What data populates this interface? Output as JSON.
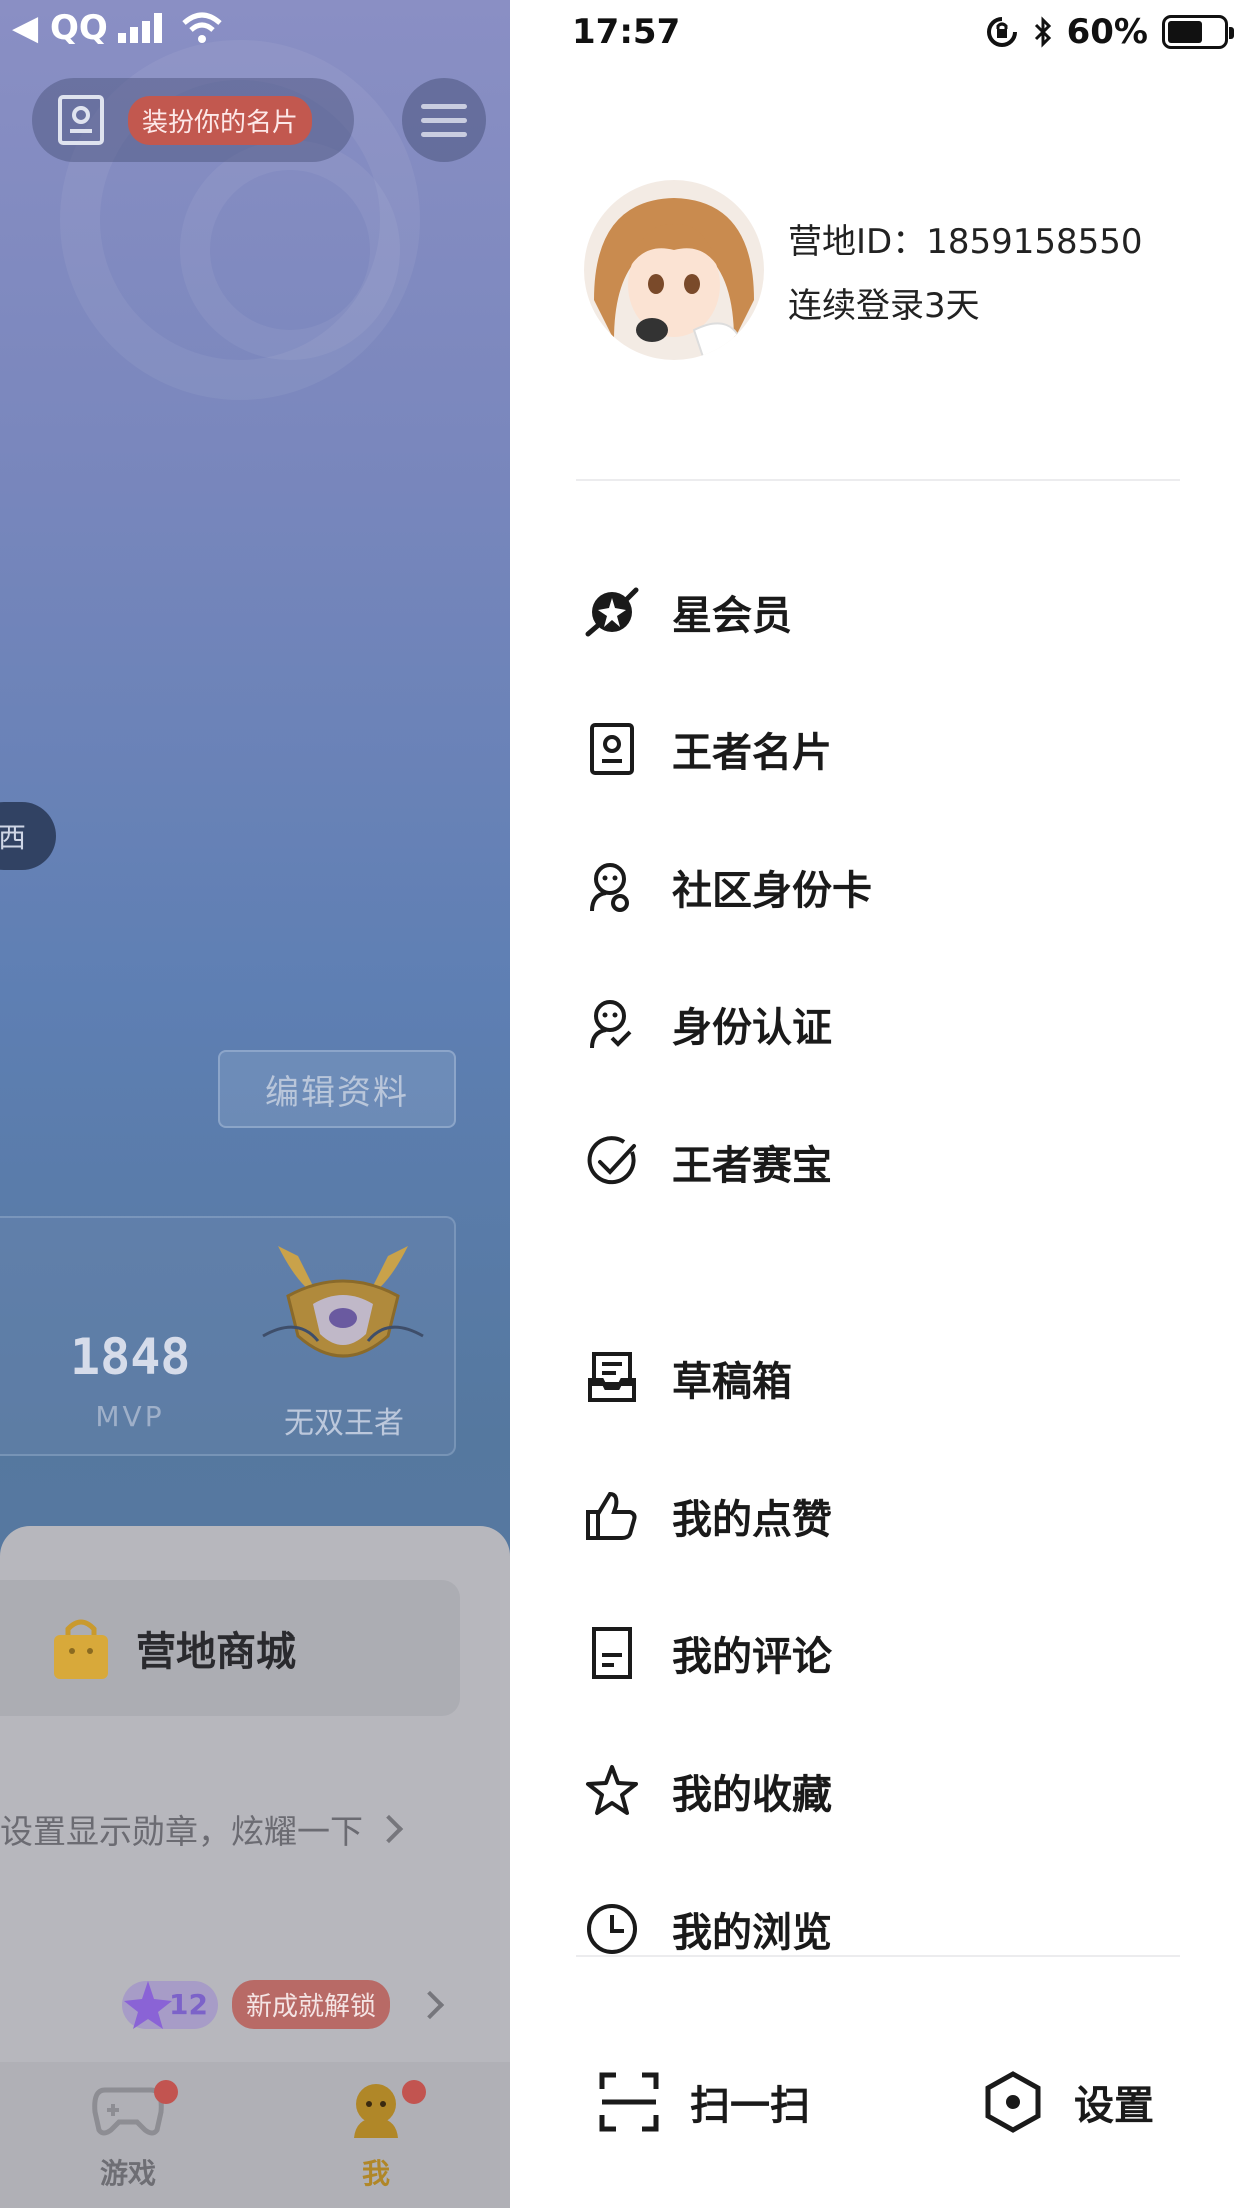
{
  "status_bar": {
    "carrier": "◀ QQ",
    "time": "17:57",
    "battery": "60%"
  },
  "background_app": {
    "card_prompt": "装扮你的名片",
    "side_chip": "西",
    "edit_profile": "编辑资料",
    "mvp_count": "1848",
    "mvp_label": "MVP",
    "rank_label": "无双王者",
    "shop_label": "营地商城",
    "medal_prompt": "设置显示勋章，炫耀一下",
    "achievement_count": "12",
    "achievement_badge": "新成就解锁",
    "tabs": [
      {
        "label": "游戏"
      },
      {
        "label": "我"
      }
    ]
  },
  "drawer": {
    "user_id": "营地ID：1859158550",
    "login_streak": "连续登录3天",
    "menu": [
      {
        "label": "星会员",
        "icon": "star-member-icon"
      },
      {
        "label": "王者名片",
        "icon": "id-card-icon"
      },
      {
        "label": "社区身份卡",
        "icon": "community-id-icon"
      },
      {
        "label": "身份认证",
        "icon": "verify-identity-icon"
      },
      {
        "label": "王者赛宝",
        "icon": "check-circle-icon"
      },
      {
        "label": "草稿箱",
        "icon": "drafts-icon"
      },
      {
        "label": "我的点赞",
        "icon": "thumbs-up-icon"
      },
      {
        "label": "我的评论",
        "icon": "comment-doc-icon"
      },
      {
        "label": "我的收藏",
        "icon": "star-outline-icon"
      },
      {
        "label": "我的浏览",
        "icon": "clock-icon"
      }
    ],
    "scan_label": "扫一扫",
    "settings_label": "设置"
  },
  "colors": {
    "accent_red": "#c2584f",
    "tab_active": "#c79a3a",
    "text_dark": "#1a1a1a"
  }
}
